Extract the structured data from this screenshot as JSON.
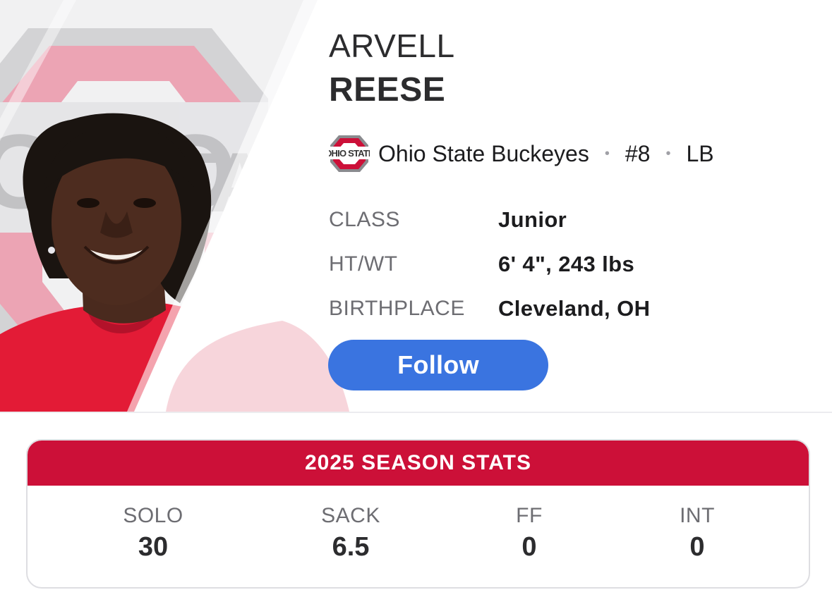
{
  "player": {
    "first_name": "ARVELL",
    "last_name": "REESE"
  },
  "team": {
    "name": "Ohio State Buckeyes",
    "number": "#8",
    "position": "LB",
    "logo_text": "OHIO STATE",
    "logo_icon": "ohio-state-logo"
  },
  "bio": [
    {
      "label": "CLASS",
      "value": "Junior"
    },
    {
      "label": "HT/WT",
      "value": "6' 4\", 243 lbs"
    },
    {
      "label": "BIRTHPLACE",
      "value": "Cleveland, OH"
    }
  ],
  "follow_label": "Follow",
  "stats": {
    "title": "2025 SEASON STATS",
    "items": [
      {
        "label": "SOLO",
        "value": "30"
      },
      {
        "label": "SACK",
        "value": "6.5"
      },
      {
        "label": "FF",
        "value": "0"
      },
      {
        "label": "INT",
        "value": "0"
      }
    ]
  },
  "colors": {
    "scarlet": "#cc1038",
    "follow_blue": "#3a74e0",
    "text_dark": "#1c1c1e",
    "text_gray": "#6d6d72"
  }
}
